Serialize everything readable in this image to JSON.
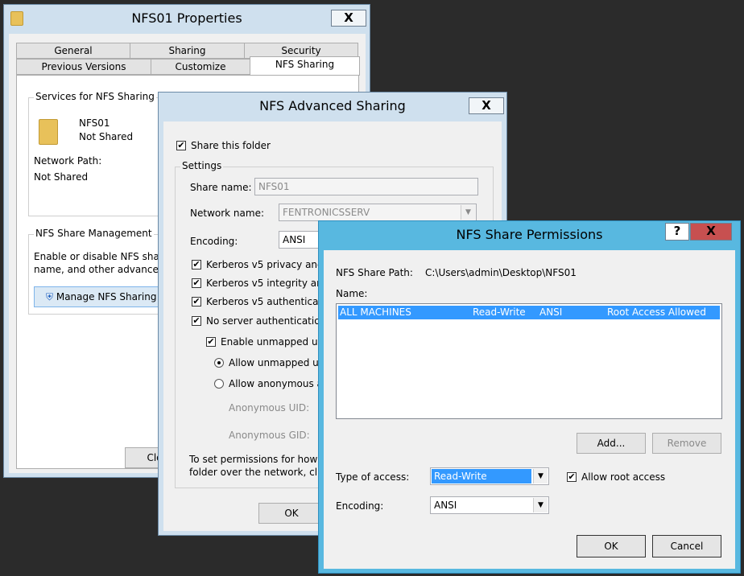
{
  "properties": {
    "title": "NFS01 Properties",
    "close": "X",
    "tabs_row1": [
      "General",
      "Sharing",
      "Security"
    ],
    "tabs_row2": [
      "Previous Versions",
      "Customize",
      "NFS Sharing"
    ],
    "services_group": "Services for NFS Sharing",
    "folder_name": "NFS01",
    "folder_status": "Not Shared",
    "network_path_label": "Network Path:",
    "network_path_value": "Not Shared",
    "mgmt_group": "NFS Share Management",
    "mgmt_text1": "Enable or disable NFS shar",
    "mgmt_text2": "name, and other advanced",
    "manage_button": "Manage NFS Sharing",
    "close_button": "Clo"
  },
  "advanced": {
    "title": "NFS Advanced Sharing",
    "close": "X",
    "share_folder": "Share this folder",
    "settings_group": "Settings",
    "share_name_label": "Share name:",
    "share_name_value": "NFS01",
    "network_name_label": "Network name:",
    "network_name_value": "FENTRONICSSERV",
    "encoding_label": "Encoding:",
    "encoding_value": "ANSI",
    "kerb1": "Kerberos v5 privacy and",
    "kerb2": "Kerberos v5 integrity and",
    "kerb3": "Kerberos v5 authenticatio",
    "no_server_auth": "No server authentication",
    "enable_unmapped": "Enable unmapped use",
    "allow_unmapped": "Allow unmapped use",
    "allow_anonymous": "Allow anonymous ac",
    "anon_uid": "Anonymous UID:",
    "anon_gid": "Anonymous GID:",
    "perm_text1": "To set permissions for how u",
    "perm_text2": "folder over the network, click",
    "ok": "OK"
  },
  "permissions": {
    "title": "NFS Share Permissions",
    "help": "?",
    "close": "X",
    "share_path_label": "NFS Share Path:",
    "share_path_value": "C:\\Users\\admin\\Desktop\\NFS01",
    "name_label": "Name:",
    "rows": [
      {
        "machine": "ALL MACHINES",
        "access": "Read-Write",
        "encoding": "ANSI",
        "root": "Root Access Allowed"
      }
    ],
    "add_button": "Add...",
    "remove_button": "Remove",
    "type_access_label": "Type of access:",
    "type_access_value": "Read-Write",
    "allow_root": "Allow root access",
    "encoding_label": "Encoding:",
    "encoding_value": "ANSI",
    "ok": "OK",
    "cancel": "Cancel"
  },
  "colors": {
    "selection": "#3399ff",
    "active_titlebar": "#58b8e0",
    "inactive_titlebar": "#cfe0ee",
    "close_red": "#c75050"
  }
}
